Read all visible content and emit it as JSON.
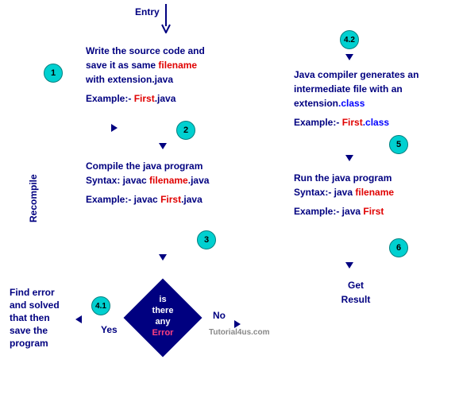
{
  "entry": "Entry",
  "step1": {
    "line1_a": "Write the source code and",
    "line2_a": "save it as same ",
    "line2_b": "filename",
    "line3_a": "with extension.java",
    "ex_a": "Example:- ",
    "ex_b": "First",
    "ex_c": ".java"
  },
  "step2": {
    "line1": "Compile the java program",
    "syn_a": "Syntax: javac ",
    "syn_b": "filename",
    "syn_c": ".java",
    "ex_a": "Example:- javac ",
    "ex_b": "First",
    "ex_c": ".java"
  },
  "step3": {
    "l1": "is",
    "l2": "there",
    "l3": "any",
    "l4": "Error"
  },
  "yes": "Yes",
  "no": "No",
  "step41": {
    "l1": "Find error",
    "l2": "and solved",
    "l3": "that then",
    "l4": "save the",
    "l5": "program"
  },
  "step42": {
    "l1": "Java compiler generates an",
    "l2": "intermediate file with an",
    "l3_a": "extension",
    "l3_b": ".class",
    "ex_a": "Example:- ",
    "ex_b": "First",
    "ex_c": ".class"
  },
  "step5": {
    "l1": "Run the java program",
    "syn_a": "Syntax:- java ",
    "syn_b": "filename",
    "ex_a": "Example:- java ",
    "ex_b": "First"
  },
  "step6": {
    "l1": "Get",
    "l2": "Result"
  },
  "recompile": "Recompile",
  "watermark": "Tutorial4us.com",
  "badges": {
    "b1": "1",
    "b2": "2",
    "b3": "3",
    "b41": "4.1",
    "b42": "4.2",
    "b5": "5",
    "b6": "6"
  }
}
